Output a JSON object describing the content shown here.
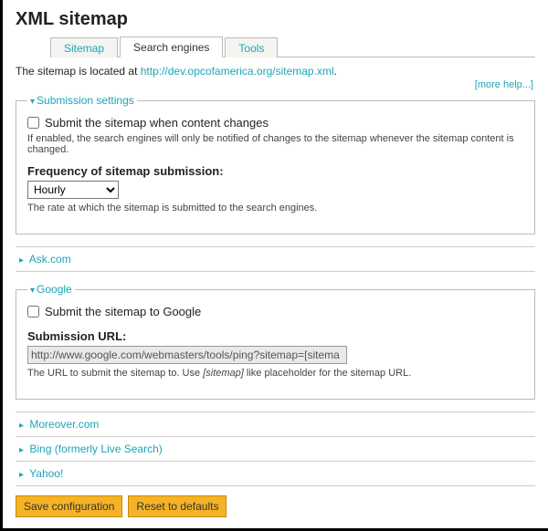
{
  "page_title": "XML sitemap",
  "tabs": [
    {
      "label": "Sitemap",
      "active": false
    },
    {
      "label": "Search engines",
      "active": true
    },
    {
      "label": "Tools",
      "active": false
    }
  ],
  "intro_text": "The sitemap is located at ",
  "intro_link": "http://dev.opcofamerica.org/sitemap.xml",
  "intro_suffix": ".",
  "more_help": "[more help...]",
  "submission_settings": {
    "legend": "Submission settings",
    "submit_on_change_label": "Submit the sitemap when content changes",
    "submit_on_change_desc": "If enabled, the search engines will only be notified of changes to the sitemap whenever the sitemap content is changed.",
    "frequency_label": "Frequency of sitemap submission:",
    "frequency_value": "Hourly",
    "frequency_desc": "The rate at which the sitemap is submitted to the search engines."
  },
  "engines": {
    "ask": {
      "legend": "Ask.com"
    },
    "google": {
      "legend": "Google",
      "submit_label": "Submit the sitemap to Google",
      "url_label": "Submission URL:",
      "url_value": "http://www.google.com/webmasters/tools/ping?sitemap=[sitema",
      "url_desc_pre": "The URL to submit the sitemap to. Use ",
      "url_desc_em": "[sitemap]",
      "url_desc_post": " like placeholder for the sitemap URL."
    },
    "moreover": {
      "legend": "Moreover.com"
    },
    "bing": {
      "legend": "Bing (formerly Live Search)"
    },
    "yahoo": {
      "legend": "Yahoo!"
    }
  },
  "buttons": {
    "save": "Save configuration",
    "reset": "Reset to defaults"
  }
}
